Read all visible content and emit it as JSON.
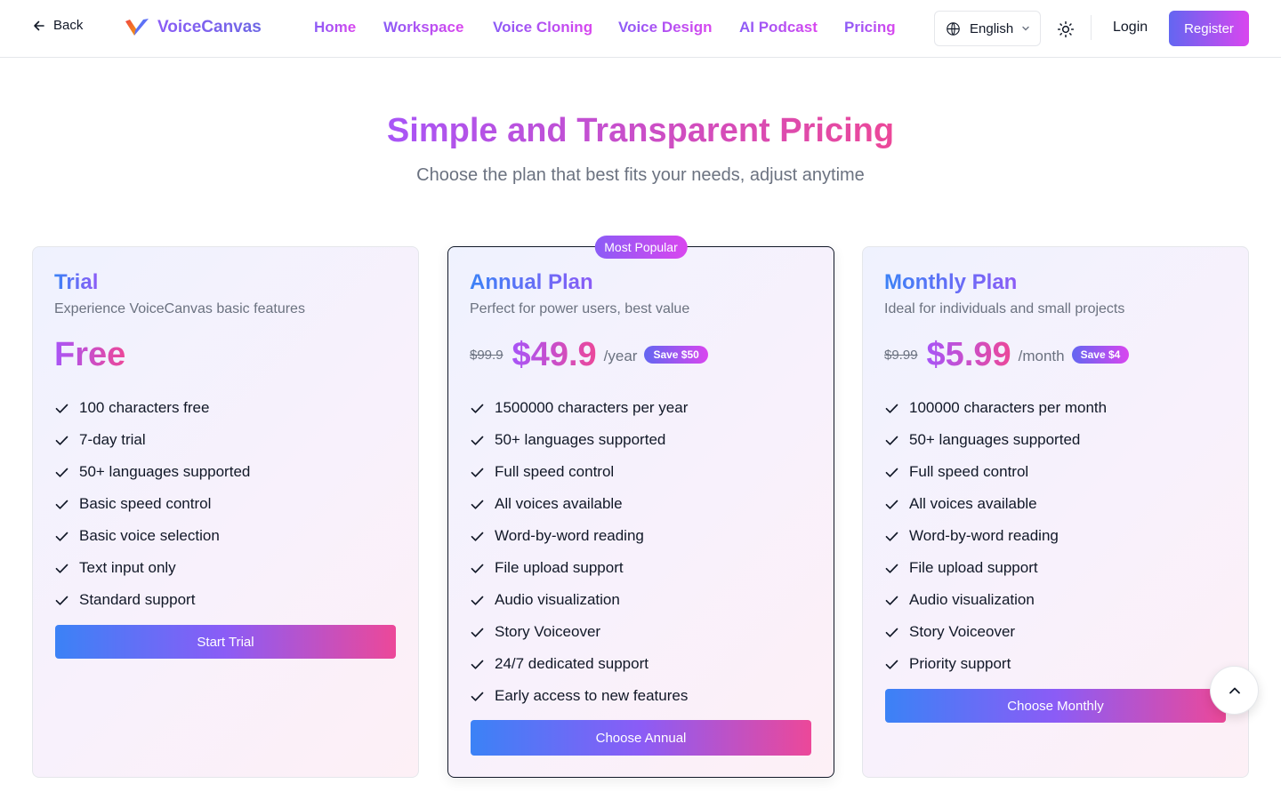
{
  "header": {
    "back_label": "Back",
    "brand": "VoiceCanvas",
    "nav": [
      "Home",
      "Workspace",
      "Voice Cloning",
      "Voice Design",
      "AI Podcast",
      "Pricing"
    ],
    "language": "English",
    "login_label": "Login",
    "register_label": "Register"
  },
  "hero": {
    "title": "Simple and Transparent Pricing",
    "subtitle": "Choose the plan that best fits your needs, adjust anytime"
  },
  "plans": [
    {
      "name": "Trial",
      "description": "Experience VoiceCanvas basic features",
      "price": "Free",
      "features": [
        "100 characters free",
        "7-day trial",
        "50+ languages supported",
        "Basic speed control",
        "Basic voice selection",
        "Text input only",
        "Standard support"
      ],
      "cta": "Start Trial"
    },
    {
      "badge": "Most Popular",
      "name": "Annual Plan",
      "description": "Perfect for power users, best value",
      "old_price": "$99.9",
      "price": "$49.9",
      "period": "/year",
      "save": "Save $50",
      "features": [
        "1500000 characters per year",
        "50+ languages supported",
        "Full speed control",
        "All voices available",
        "Word-by-word reading",
        "File upload support",
        "Audio visualization",
        "Story Voiceover",
        "24/7 dedicated support",
        "Early access to new features"
      ],
      "cta": "Choose Annual"
    },
    {
      "name": "Monthly Plan",
      "description": "Ideal for individuals and small projects",
      "old_price": "$9.99",
      "price": "$5.99",
      "period": "/month",
      "save": "Save $4",
      "features": [
        "100000 characters per month",
        "50+ languages supported",
        "Full speed control",
        "All voices available",
        "Word-by-word reading",
        "File upload support",
        "Audio visualization",
        "Story Voiceover",
        "Priority support"
      ],
      "cta": "Choose Monthly"
    }
  ]
}
